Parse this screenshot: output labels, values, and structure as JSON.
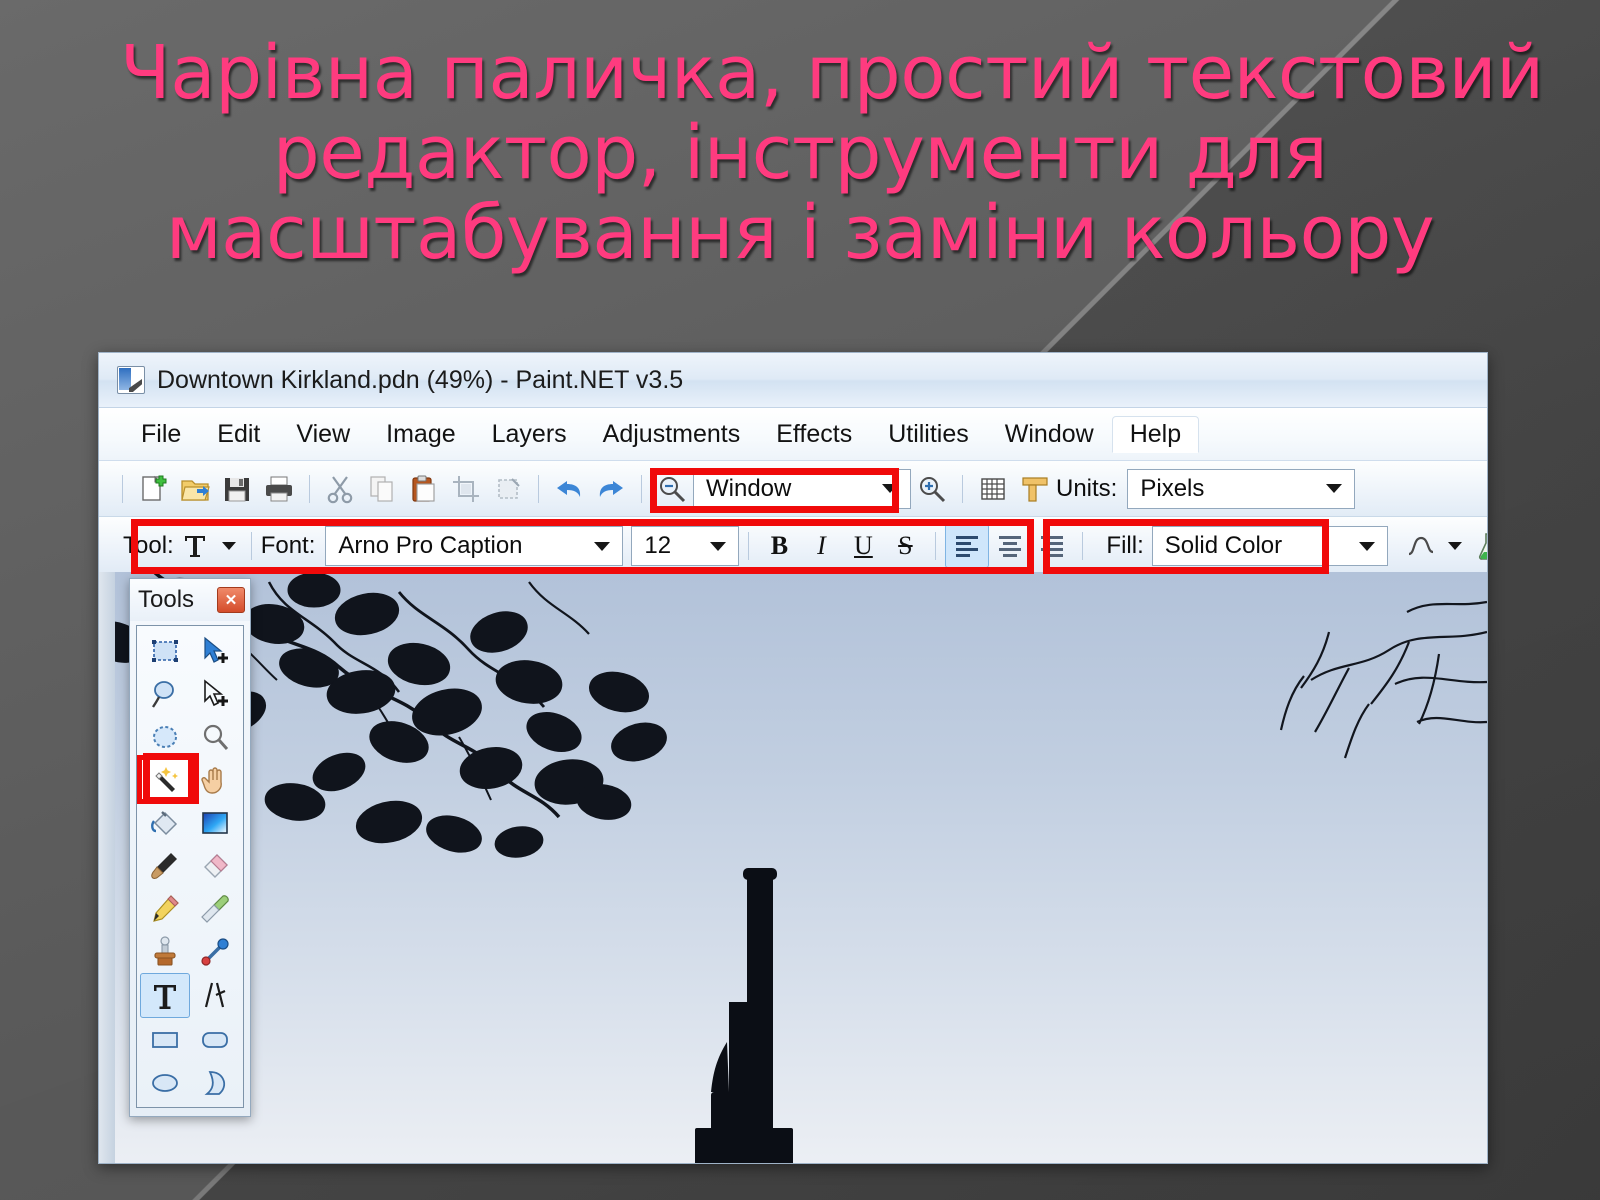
{
  "slide": {
    "background_color": "#5b5b5b",
    "title_color": "#ff3b7f",
    "title_lines": [
      "Чарівна паличка, простий текстовий",
      "редактор, інструменти для",
      "масштабування і заміни кольору"
    ]
  },
  "app": {
    "window_title": "Downtown Kirkland.pdn (49%) - Paint.NET v3.5",
    "document_name": "Downtown Kirkland.pdn",
    "zoom_percent": "49%",
    "app_name": "Paint.NET v3.5",
    "app_icon": "paintnet-icon",
    "menu": [
      {
        "label": "File",
        "name": "menu-file"
      },
      {
        "label": "Edit",
        "name": "menu-edit"
      },
      {
        "label": "View",
        "name": "menu-view"
      },
      {
        "label": "Image",
        "name": "menu-image"
      },
      {
        "label": "Layers",
        "name": "menu-layers"
      },
      {
        "label": "Adjustments",
        "name": "menu-adjustments"
      },
      {
        "label": "Effects",
        "name": "menu-effects"
      },
      {
        "label": "Utilities",
        "name": "menu-utilities"
      },
      {
        "label": "Window",
        "name": "menu-window"
      },
      {
        "label": "Help",
        "name": "menu-help"
      }
    ],
    "toolbar_main": {
      "icons": [
        "new-file-icon",
        "open-file-icon",
        "save-icon",
        "print-icon",
        "cut-icon",
        "copy-icon",
        "paste-icon",
        "crop-to-selection-icon",
        "deselect-icon",
        "undo-icon",
        "redo-icon"
      ],
      "zoom_out_icon": "zoom-out-icon",
      "zoom_level": "Window",
      "zoom_in_icon": "zoom-in-icon",
      "grid_icon": "grid-icon",
      "rulers_icon": "rulers-icon",
      "units_label": "Units:",
      "units_value": "Pixels"
    },
    "toolbar_text": {
      "tool_label": "Tool:",
      "tool_icon": "text-tool-icon",
      "font_label": "Font:",
      "font_family": "Arno Pro Caption",
      "font_size": "12",
      "bold_label": "B",
      "italic_label": "I",
      "underline_label": "U",
      "strikethrough_label": "S",
      "align_left_icon": "align-left-icon",
      "align_center_icon": "align-center-icon",
      "align_right_icon": "align-right-icon",
      "align_selected": "align-left-icon",
      "fill_label": "Fill:",
      "fill_value": "Solid Color",
      "antialiasing_icon": "antialiasing-icon",
      "blend_mode_icon": "blend-mode-flask-icon"
    },
    "tools_panel": {
      "title": "Tools",
      "close_label": "✕",
      "tools": [
        {
          "name": "rectangle-select-tool",
          "selected": "none"
        },
        {
          "name": "move-selected-pixels-tool",
          "selected": "none"
        },
        {
          "name": "lasso-select-tool",
          "selected": "none"
        },
        {
          "name": "move-selection-tool",
          "selected": "none"
        },
        {
          "name": "ellipse-select-tool",
          "selected": "none"
        },
        {
          "name": "zoom-tool",
          "selected": "none"
        },
        {
          "name": "magic-wand-tool",
          "selected": "red"
        },
        {
          "name": "pan-tool",
          "selected": "none"
        },
        {
          "name": "paint-bucket-tool",
          "selected": "none"
        },
        {
          "name": "gradient-tool",
          "selected": "none"
        },
        {
          "name": "paintbrush-tool",
          "selected": "none"
        },
        {
          "name": "eraser-tool",
          "selected": "none"
        },
        {
          "name": "pencil-tool",
          "selected": "none"
        },
        {
          "name": "color-picker-tool",
          "selected": "none"
        },
        {
          "name": "clone-stamp-tool",
          "selected": "none"
        },
        {
          "name": "recolor-tool",
          "selected": "none"
        },
        {
          "name": "text-tool",
          "selected": "blue"
        },
        {
          "name": "line-curve-tool",
          "selected": "none"
        },
        {
          "name": "rectangle-shape-tool",
          "selected": "none"
        },
        {
          "name": "rounded-rectangle-shape-tool",
          "selected": "none"
        },
        {
          "name": "ellipse-shape-tool",
          "selected": "none"
        },
        {
          "name": "freeform-shape-tool",
          "selected": "none"
        }
      ]
    },
    "annotations": {
      "highlight_color": "#f00a0a",
      "boxes": [
        {
          "name": "highlight-zoom-controls"
        },
        {
          "name": "highlight-text-tool-options"
        },
        {
          "name": "highlight-fill-options"
        },
        {
          "name": "highlight-magic-wand-tool"
        }
      ]
    },
    "canvas_image": {
      "description": "Photo of bare tree branches silhouetted against a pale blue sky with a dark pole",
      "sky_color": "#c3d0e0",
      "silhouette_color": "#0d1018"
    }
  }
}
